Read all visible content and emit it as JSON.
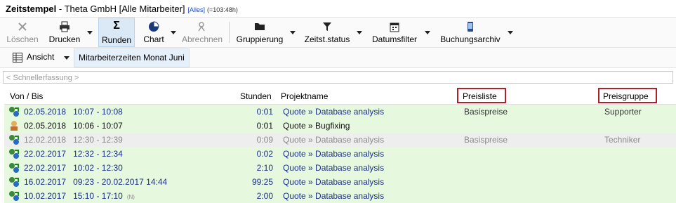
{
  "title": {
    "name": "Zeitstempel",
    "company": "Theta GmbH [Alle Mitarbeiter]",
    "tag": "[Alles]",
    "count": "(=103:48h)"
  },
  "toolbar": {
    "delete": "Löschen",
    "print": "Drucken",
    "round": "Runden",
    "chart": "Chart",
    "bill": "Abrechnen",
    "group": "Gruppierung",
    "status": "Zeitst.status",
    "datefilter": "Datumsfilter",
    "archive": "Buchungsarchiv"
  },
  "view": {
    "label": "Ansicht",
    "tab": "Mitarbeiterzeiten Monat Juni"
  },
  "quick": {
    "placeholder": "< Schnellerfassung >"
  },
  "columns": {
    "vonbis": "Von / Bis",
    "stunden": "Stunden",
    "projekt": "Projektname",
    "preisliste": "Preisliste",
    "preisgruppe": "Preisgruppe"
  },
  "rows": [
    {
      "date": "02.05.2018",
      "time": "10:07 - 10:08",
      "hours": "0:01",
      "project": "Quote » Database analysis",
      "pricelist": "Basispreise",
      "pricegroup": "Supporter"
    },
    {
      "date": "02.05.2018",
      "time": "10:06 - 10:07",
      "hours": "0:01",
      "project": "Quote » Bugfixing",
      "pricelist": "",
      "pricegroup": ""
    },
    {
      "date": "12.02.2018",
      "time": "12:30 - 12:39",
      "hours": "0:09",
      "project": "Quote » Database analysis",
      "pricelist": "Basispreise",
      "pricegroup": "Techniker"
    },
    {
      "date": "22.02.2017",
      "time": "12:32 - 12:34",
      "hours": "0:02",
      "project": "Quote » Database analysis",
      "pricelist": "",
      "pricegroup": ""
    },
    {
      "date": "22.02.2017",
      "time": "10:02 - 12:30",
      "hours": "2:10",
      "project": "Quote » Database analysis",
      "pricelist": "",
      "pricegroup": ""
    },
    {
      "date": "16.02.2017",
      "time": "09:23 - 20.02.2017 14:44",
      "hours": "99:25",
      "project": "Quote » Database analysis",
      "pricelist": "",
      "pricegroup": ""
    },
    {
      "date": "10.02.2017",
      "time": "15:10 - 17:10",
      "flag": "(N)",
      "hours": "2:00",
      "project": "Quote » Database analysis",
      "pricelist": "",
      "pricegroup": ""
    }
  ],
  "colors": {
    "rowGreen": "#e6f9de",
    "rowGrey": "#eeeeee",
    "highlight": "#b0202a",
    "link": "#1a2d8c"
  }
}
